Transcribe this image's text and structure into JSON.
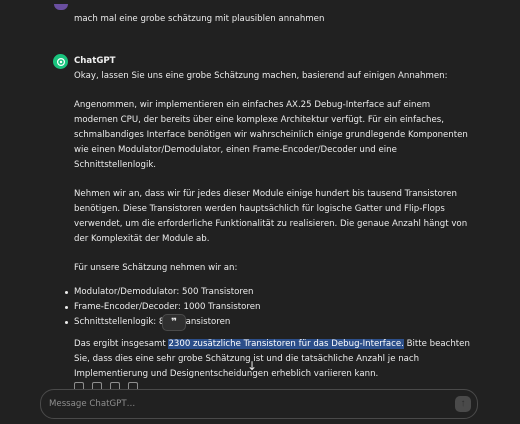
{
  "user_message": "mach mal eine grobe schätzung mit plausiblen annahmen",
  "assistant": {
    "name": "ChatGPT",
    "intro": "Okay, lassen Sie uns eine grobe Schätzung machen, basierend auf einigen Annahmen:",
    "para1": "Angenommen, wir implementieren ein einfaches AX.25 Debug-Interface auf einem modernen CPU, der bereits über eine komplexe Architektur verfügt. Für ein einfaches, schmalbandiges Interface benötigen wir wahrscheinlich einige grundlegende Komponenten wie einen Modulator/Demodulator, einen Frame-Encoder/Decoder und eine Schnittstellenlogik.",
    "para2": "Nehmen wir an, dass wir für jedes dieser Module einige hundert bis tausend Transistoren benötigen. Diese Transistoren werden hauptsächlich für logische Gatter und Flip-Flops verwendet, um die erforderliche Funktionalität zu realisieren. Die genaue Anzahl hängt von der Komplexität der Module ab.",
    "list_intro": "Für unsere Schätzung nehmen wir an:",
    "items": [
      "Modulator/Demodulator: 500 Transistoren",
      "Frame-Encoder/Decoder: 1000 Transistoren",
      "Schnittstellenlogik: 800 Transistoren"
    ],
    "summary_before": "Das ergibt insgesamt ",
    "summary_highlight": "2300 zusätzliche Transistoren für das Debug-Interface.",
    "summary_after": " Bitte beachten Sie, dass dies eine sehr grobe Schätzung ist und die tatsächliche Anzahl je nach Implementierung und Designentscheidungen erheblich variieren kann."
  },
  "quote_popup": "❞",
  "composer": {
    "placeholder": "Message ChatGPT…"
  },
  "icons": {
    "assistant_avatar": "openai-logo-icon",
    "scroll_down": "arrow-down-icon",
    "send": "arrow-up-icon",
    "quote": "quote-icon"
  },
  "colors": {
    "background": "#212121",
    "text": "#ececec",
    "highlight": "#2c4f8a",
    "avatar": "#19c37d"
  }
}
